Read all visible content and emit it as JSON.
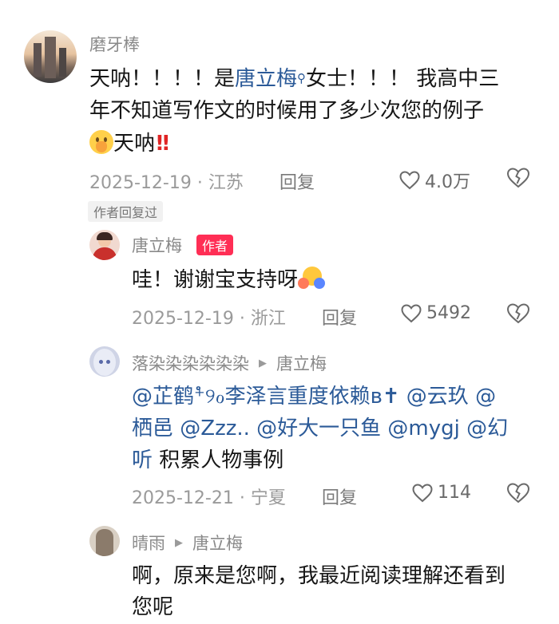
{
  "comments": [
    {
      "user": "磨牙棒",
      "text": {
        "part1": "天呐！！！！是",
        "mention": "唐立梅",
        "part2": "女士！！！ 我高中三",
        "line2": "年不知道写作文的时候用了多少次您的例子",
        "line3": "天呐"
      },
      "date_location": "2025-12-19 · 江苏",
      "reply_label": "回复",
      "likes": "4.0万",
      "author_replied_badge": "作者回复过"
    }
  ],
  "replies": [
    {
      "user": "唐立梅",
      "badge": "作者",
      "text": "哇！谢谢宝支持呀",
      "date_location": "2025-12-19 · 浙江",
      "reply_label": "回复",
      "likes": "5492"
    },
    {
      "user": "落染染染染染染",
      "reply_to": "唐立梅",
      "line1": "@芷鹤⁺ໍ୨ℴ李泽言重度依赖ʙ✝ @云玖 @",
      "line2a": "栖邑 @Zzz.. @好大一只鱼 @mygj @幻",
      "line3a": "听",
      "line3b": " 积累人物事例",
      "date_location": "2025-12-21 · 宁夏",
      "reply_label": "回复",
      "likes": "114"
    },
    {
      "user": "晴雨",
      "reply_to": "唐立梅",
      "line1": "啊，原来是您啊，我最近阅读理解还看到",
      "line2": "您呢"
    }
  ],
  "icons": {
    "like": "heart-outline-icon",
    "dislike": "broken-heart-icon",
    "reply_arrow": "triangle-right-icon",
    "search_hint": "magnifier-icon"
  },
  "colors": {
    "mention": "#2b5a98",
    "author_badge": "#ff2e55",
    "secondary_text": "#8a8a8a"
  }
}
